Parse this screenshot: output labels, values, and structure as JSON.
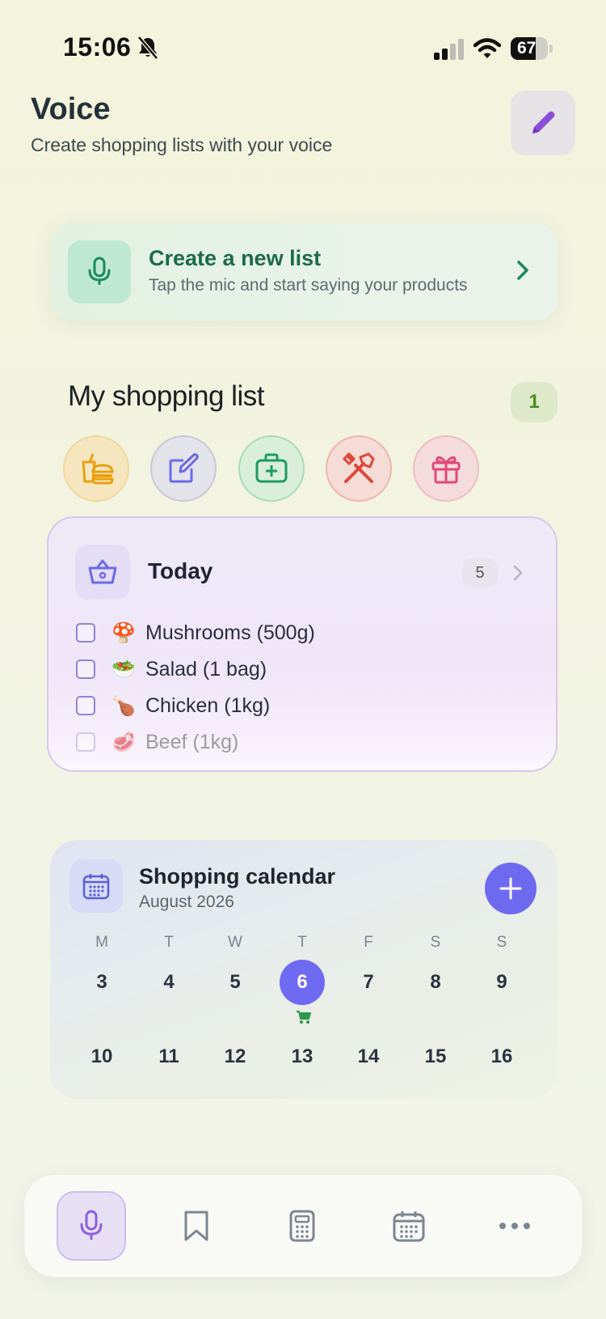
{
  "status_bar": {
    "time": "15:06",
    "battery": "67",
    "battery_level": 0.67
  },
  "header": {
    "title": "Voice",
    "subtitle": "Create shopping lists with your voice"
  },
  "create_card": {
    "title": "Create a new list",
    "subtitle": "Tap the mic and start saying your products"
  },
  "shopping": {
    "title": "My shopping list",
    "count": "1",
    "categories": [
      "food-drink-icon",
      "notes-icon",
      "health-icon",
      "tools-icon",
      "gifts-icon"
    ]
  },
  "today_list": {
    "title": "Today",
    "count": "5",
    "items": [
      {
        "emoji": "🍄",
        "label": "Mushrooms (500g)"
      },
      {
        "emoji": "🥗",
        "label": "Salad (1 bag)"
      },
      {
        "emoji": "🍗",
        "label": "Chicken (1kg)"
      },
      {
        "emoji": "🥩",
        "label": "Beef (1kg)"
      }
    ]
  },
  "calendar": {
    "title": "Shopping calendar",
    "month": "August 2026",
    "weekdays": [
      "M",
      "T",
      "W",
      "T",
      "F",
      "S",
      "S"
    ],
    "week1": [
      "3",
      "4",
      "5",
      "6",
      "7",
      "8",
      "9"
    ],
    "week2": [
      "10",
      "11",
      "12",
      "13",
      "14",
      "15",
      "16"
    ],
    "selected_day": "6"
  },
  "bottom_nav": [
    "mic-icon",
    "bookmark-icon",
    "calculator-icon",
    "calendar-icon",
    "more-icon"
  ],
  "colors": {
    "accent": "#6e6af0",
    "green": "#1d6a49",
    "badge_green": "#4d8c22"
  }
}
